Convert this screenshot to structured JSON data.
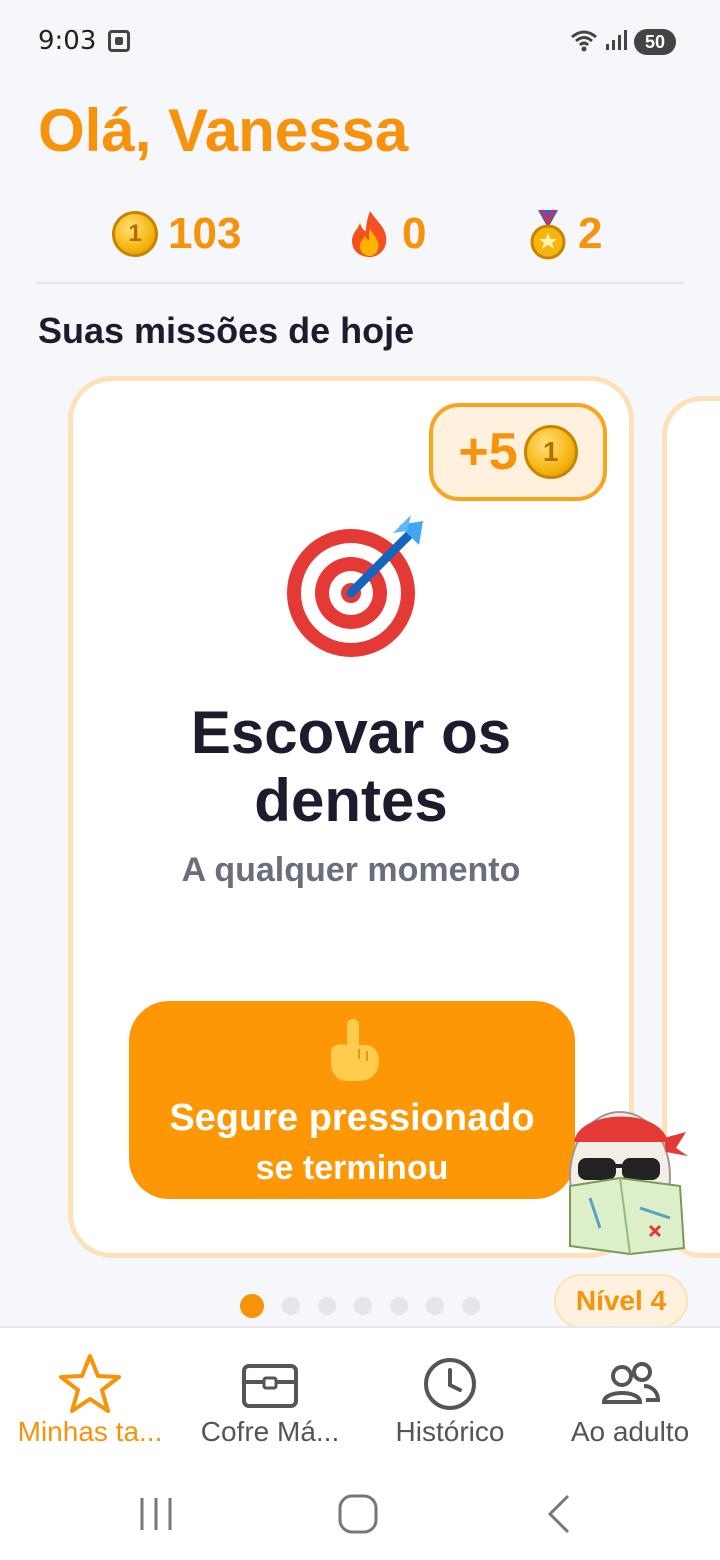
{
  "status_bar": {
    "time": "9:03",
    "battery": "50"
  },
  "greeting": "Olá, Vanessa",
  "stats": {
    "coins": "103",
    "streak": "0",
    "medals": "2"
  },
  "section_title": "Suas missões de hoje",
  "mission": {
    "reward": "+5",
    "title_line1": "Escovar os",
    "title_line2": "dentes",
    "subtitle": "A qualquer momento",
    "hold_line1": "Segure pressionado",
    "hold_line2": "se terminou"
  },
  "pagination": {
    "total": 7,
    "active": 1
  },
  "level": "Nível 4",
  "nav": [
    {
      "label": "Minhas ta...",
      "icon": "star-icon",
      "active": true
    },
    {
      "label": "Cofre Má...",
      "icon": "chest-icon",
      "active": false
    },
    {
      "label": "Histórico",
      "icon": "clock-icon",
      "active": false
    },
    {
      "label": "Ao adulto",
      "icon": "people-icon",
      "active": false
    }
  ],
  "colors": {
    "accent": "#f7920b",
    "button": "#fd9705",
    "card_border": "#fde1b8"
  }
}
